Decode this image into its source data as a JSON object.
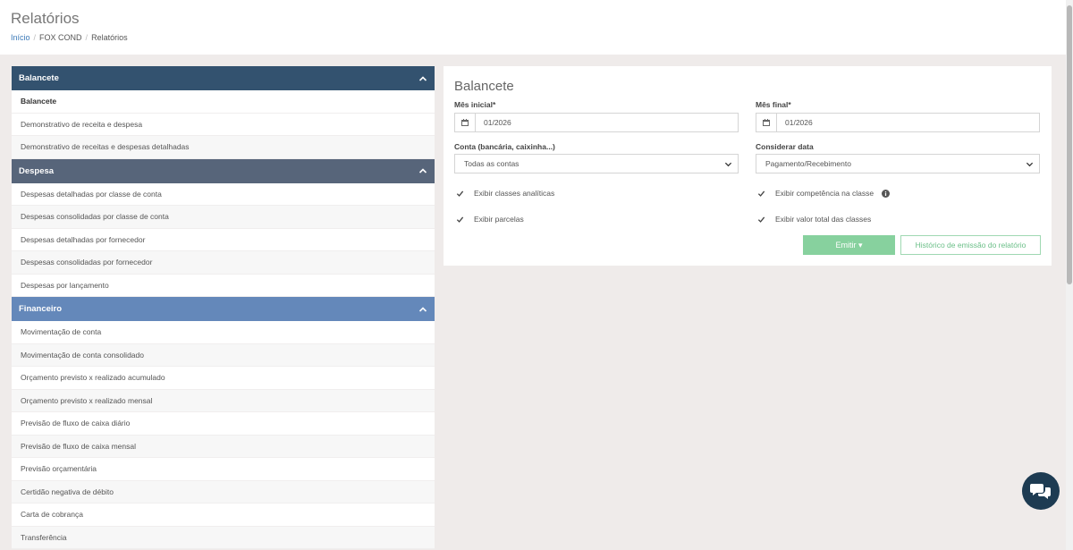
{
  "header": {
    "title": "Relatórios",
    "breadcrumb": [
      "Início",
      "FOX COND",
      "Relatórios"
    ]
  },
  "sidebar": {
    "sections": [
      {
        "title": "Balancete",
        "color": "#33526f",
        "items": [
          "Balancete",
          "Demonstrativo de receita e despesa",
          "Demonstrativo de receitas e despesas detalhadas"
        ]
      },
      {
        "title": "Despesa",
        "color": "#57657a",
        "items": [
          "Despesas detalhadas por classe de conta",
          "Despesas consolidadas por classe de conta",
          "Despesas detalhadas por fornecedor",
          "Despesas consolidadas por fornecedor",
          "Despesas por lançamento"
        ]
      },
      {
        "title": "Financeiro",
        "color": "#6488ba",
        "items": [
          "Movimentação de conta",
          "Movimentação de conta consolidado",
          "Orçamento previsto x realizado acumulado",
          "Orçamento previsto x realizado mensal",
          "Previsão de fluxo de caixa diário",
          "Previsão de fluxo de caixa mensal",
          "Previsão orçamentária",
          "Certidão negativa de débito",
          "Carta de cobrança",
          "Transferência"
        ]
      }
    ]
  },
  "form": {
    "title": "Balancete",
    "mes_inicial_label": "Mês inicial*",
    "mes_inicial_value": "01/2026",
    "mes_final_label": "Mês final*",
    "mes_final_value": "01/2026",
    "conta_label": "Conta (bancária, caixinha...)",
    "conta_value": "Todas as contas",
    "considerar_label": "Considerar data",
    "considerar_value": "Pagamento/Recebimento",
    "checks": {
      "classes_analiticas": "Exibir classes analíticas",
      "parcelas": "Exibir parcelas",
      "competencia": "Exibir competência na classe",
      "valor_total": "Exibir valor total das classes"
    },
    "emit_label": "Emitir ▾",
    "history_label": "Histórico de emissão do relatório"
  },
  "colors": {
    "accent_green": "#87d19e",
    "balancete_header": "#33526f",
    "despesa_header": "#57657a",
    "financeiro_header": "#6488ba",
    "chat_button": "#1d3b52"
  },
  "icons": [
    "calendar-icon",
    "chevron-up-icon",
    "chevron-down-icon",
    "check-icon",
    "info-icon",
    "chat-icon"
  ]
}
